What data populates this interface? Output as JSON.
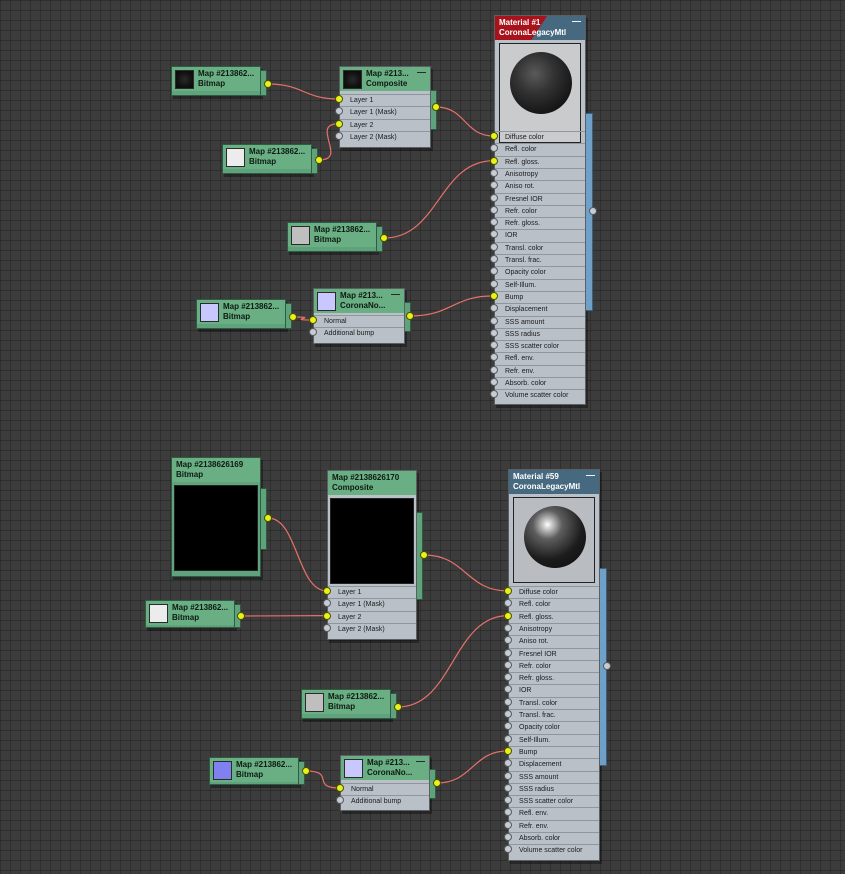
{
  "graph_top": {
    "material": {
      "title": "Material #1",
      "type": "CoronaLegacyMtl",
      "min_label": "—",
      "flag_color": "#a8131b",
      "slots": [
        "Diffuse color",
        "Refl. color",
        "Refl. gloss.",
        "Anisotropy",
        "Aniso rot.",
        "Fresnel IOR",
        "Refr. color",
        "Refr. gloss.",
        "IOR",
        "Transl. color",
        "Transl. frac.",
        "Opacity color",
        "Self-Illum.",
        "Bump",
        "Displacement",
        "SSS amount",
        "SSS radius",
        "SSS scatter color",
        "Refl. env.",
        "Refr. env.",
        "Absorb. color",
        "Volume scatter color"
      ],
      "connected_slots": [
        0,
        2,
        13
      ]
    },
    "composite": {
      "title": "Map #213...",
      "type": "Composite",
      "min_label": "—",
      "slots": [
        "Layer 1",
        "Layer 1 (Mask)",
        "Layer 2",
        "Layer 2 (Mask)"
      ],
      "connected_slots": [
        0,
        2
      ]
    },
    "bitmap_a": {
      "title": "Map #213862...",
      "type": "Bitmap"
    },
    "bitmap_b": {
      "title": "Map #213862...",
      "type": "Bitmap"
    },
    "bitmap_c": {
      "title": "Map #213862...",
      "type": "Bitmap"
    },
    "bitmap_d": {
      "title": "Map #213862...",
      "type": "Bitmap"
    },
    "normal": {
      "title": "Map #213...",
      "type": "CoronaNo...",
      "min_label": "—",
      "slots": [
        "Normal",
        "Additional bump"
      ],
      "connected_slots": [
        0
      ]
    }
  },
  "graph_bottom": {
    "material": {
      "title": "Material #59",
      "type": "CoronaLegacyMtl",
      "min_label": "—",
      "slots": [
        "Diffuse color",
        "Refl. color",
        "Refl. gloss.",
        "Anisotropy",
        "Aniso rot.",
        "Fresnel IOR",
        "Refr. color",
        "Refr. gloss.",
        "IOR",
        "Transl. color",
        "Transl. frac.",
        "Opacity color",
        "Self-Illum.",
        "Bump",
        "Displacement",
        "SSS amount",
        "SSS radius",
        "SSS scatter color",
        "Refl. env.",
        "Refr. env.",
        "Absorb. color",
        "Volume scatter color"
      ],
      "connected_slots": [
        0,
        2,
        13
      ]
    },
    "composite": {
      "title": "Map #2138626170",
      "type": "Composite",
      "min_label": "—",
      "slots": [
        "Layer 1",
        "Layer 1 (Mask)",
        "Layer 2",
        "Layer 2 (Mask)"
      ],
      "connected_slots": [
        0,
        2
      ]
    },
    "bitmap_a": {
      "title": "Map #2138626169",
      "type": "Bitmap"
    },
    "bitmap_b": {
      "title": "Map #213862...",
      "type": "Bitmap"
    },
    "bitmap_c": {
      "title": "Map #213862...",
      "type": "Bitmap"
    },
    "bitmap_d": {
      "title": "Map #213862...",
      "type": "Bitmap"
    },
    "normal": {
      "title": "Map #213...",
      "type": "CoronaNo...",
      "min_label": "—",
      "slots": [
        "Normal",
        "Additional bump"
      ],
      "connected_slots": [
        0
      ]
    }
  },
  "colors": {
    "wire": "#e8706a",
    "map_node": "#5fa37c",
    "material_header": "#46697f",
    "port_connected": "#e6f21a",
    "canvas": "#3c3c3c"
  },
  "icons": [
    "minimize-icon",
    "swatch-icon",
    "port-icon",
    "sphere-preview"
  ]
}
